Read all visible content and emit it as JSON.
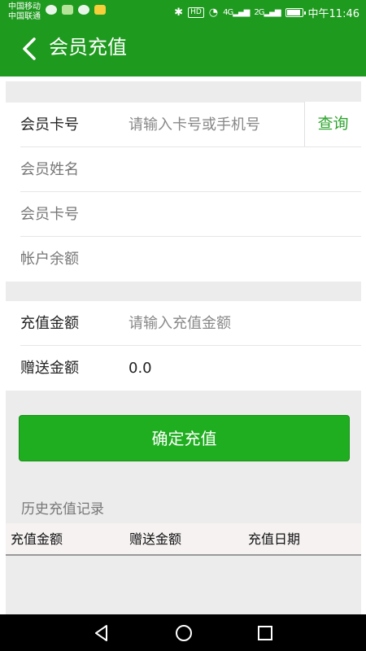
{
  "status_bar": {
    "carrier1": "中国移动",
    "carrier2": "中国联通",
    "hd": "HD",
    "net1": "4G",
    "net2": "2G",
    "time": "中午11:46"
  },
  "header": {
    "title": "会员充值"
  },
  "member": {
    "card_label": "会员卡号",
    "card_placeholder": "请输入卡号或手机号",
    "query_button": "查询",
    "name_label": "会员姓名",
    "card_no_label": "会员卡号",
    "balance_label": "帐户余额"
  },
  "recharge": {
    "amount_label": "充值金额",
    "amount_placeholder": "请输入充值金额",
    "bonus_label": "赠送金额",
    "bonus_value": "0.0"
  },
  "confirm_button": "确定充值",
  "history": {
    "title": "历史充值记录",
    "columns": [
      "充值金额",
      "赠送金额",
      "充值日期"
    ]
  },
  "colors": {
    "brand_green": "#1e9a1e",
    "button_green": "#1fae1f",
    "query_green": "#2ea52e"
  }
}
